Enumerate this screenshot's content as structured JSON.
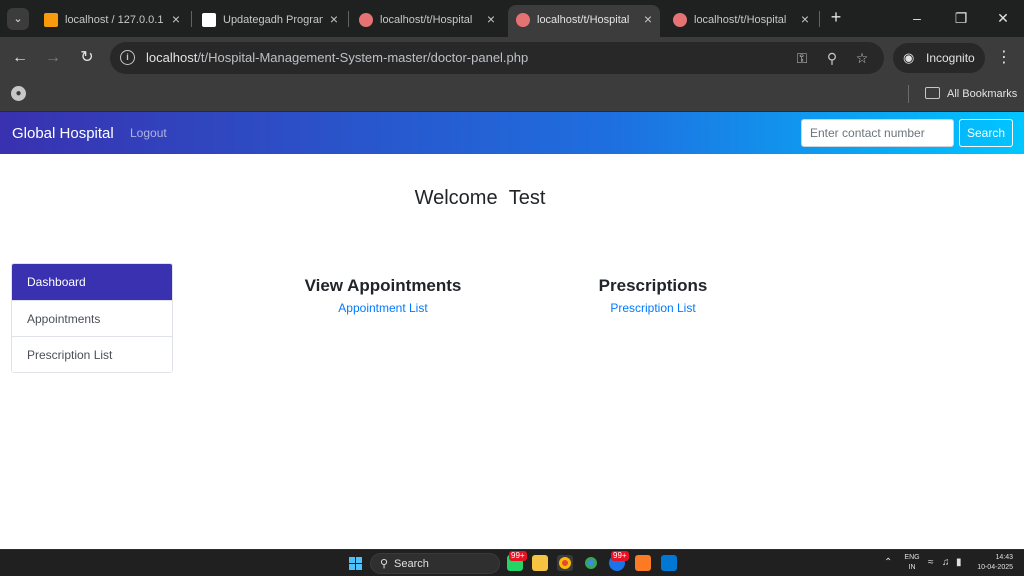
{
  "browser": {
    "tabs": [
      {
        "title": "localhost / 127.0.0.1",
        "favicon_color": "#f89c0e"
      },
      {
        "title": "Updategadh Programming",
        "favicon_color": "#ffffff"
      },
      {
        "title": "localhost/t/Hospital",
        "favicon_color": "#e57373"
      },
      {
        "title": "localhost/t/Hospital",
        "favicon_color": "#e57373"
      },
      {
        "title": "localhost/t/Hospital",
        "favicon_color": "#e57373"
      }
    ],
    "active_tab_index": 3,
    "url_host": "localhost",
    "url_path": "/t/Hospital-Management-System-master/doctor-panel.php",
    "profile_label": "Incognito",
    "bookmarks_label": "All Bookmarks",
    "icons": {
      "tab_search": "chevron-down-icon",
      "back": "arrow-left-icon",
      "forward": "arrow-right-icon",
      "reload": "reload-icon",
      "site_info": "info-icon",
      "password": "key-icon",
      "zoom": "zoom-icon",
      "bookmark": "star-icon",
      "menu": "kebab-icon"
    }
  },
  "app": {
    "brand": "Global Hospital",
    "logout_label": "Logout",
    "search": {
      "placeholder": "Enter contact number",
      "button_label": "Search"
    },
    "welcome_label": "Welcome",
    "user_name": "Test",
    "sidebar": {
      "items": [
        {
          "label": "Dashboard",
          "active": true
        },
        {
          "label": "Appointments",
          "active": false
        },
        {
          "label": "Prescription List",
          "active": false
        }
      ]
    },
    "cards": [
      {
        "heading": "View Appointments",
        "link": "Appointment List"
      },
      {
        "heading": "Prescriptions",
        "link": "Prescription List"
      }
    ],
    "colors": {
      "navbar_start": "#3931af",
      "navbar_end": "#00c6ff",
      "active_item": "#3931af",
      "link": "#007bff"
    }
  },
  "taskbar": {
    "search_label": "Search",
    "badges": [
      "99+",
      "99+"
    ],
    "lang_line1": "ENG",
    "lang_line2": "IN",
    "time": "14:43",
    "date": "10-04-2025"
  }
}
